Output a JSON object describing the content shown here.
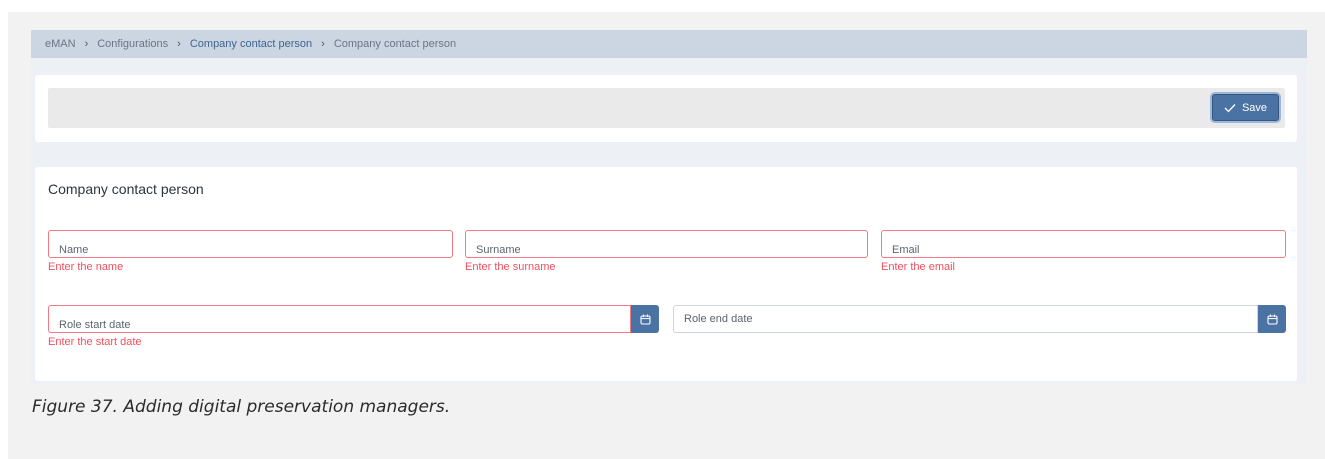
{
  "breadcrumb": {
    "items": [
      "eMAN",
      "Configurations",
      "Company contact person",
      "Company contact person"
    ],
    "separator": "›"
  },
  "toolbar": {
    "save_label": "Save"
  },
  "form": {
    "title": "Company contact person",
    "fields": {
      "name": {
        "label": "Name",
        "error": "Enter the name"
      },
      "surname": {
        "label": "Surname",
        "error": "Enter the surname"
      },
      "email": {
        "label": "Email",
        "error": "Enter the email"
      },
      "role_start": {
        "label": "Role start date",
        "error": "Enter the start date"
      },
      "role_end": {
        "label": "Role end date"
      }
    }
  },
  "caption": "Figure 37. Adding digital preservation managers.",
  "colors": {
    "accent": "#4a73a4",
    "error": "#f0505e",
    "breadcrumb_bg": "#ccd5e2"
  },
  "icons": {
    "save": "check-icon",
    "date_picker": "calendar-icon"
  }
}
